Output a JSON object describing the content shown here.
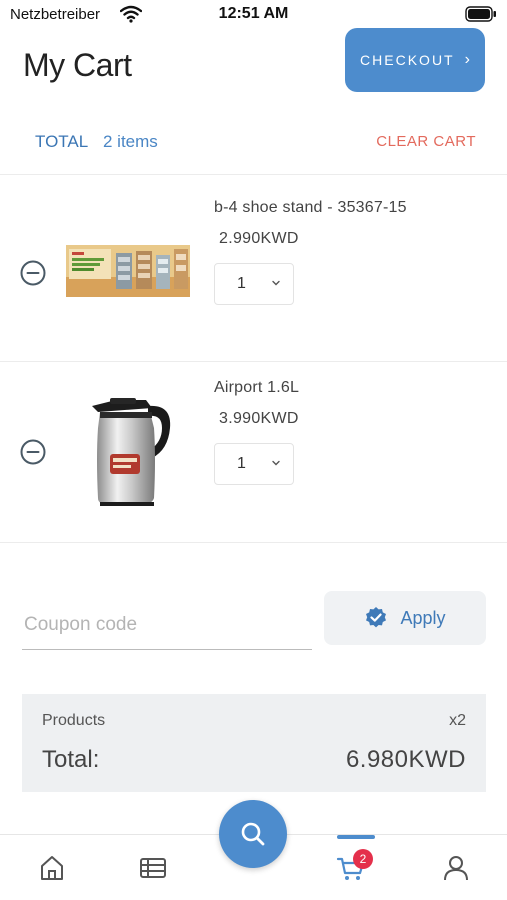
{
  "status_bar": {
    "carrier": "Netzbetreiber",
    "time": "12:51 AM"
  },
  "header": {
    "title": "My Cart",
    "checkout_label": "CHECKOUT",
    "checkout_icon": "chevron-right-icon"
  },
  "summary_row": {
    "total_label": "TOTAL",
    "items_count": "2 items",
    "clear_label": "CLEAR CART"
  },
  "cart_items": [
    {
      "name": "b-4 shoe stand - 35367-15",
      "price": "2.990KWD",
      "quantity": "1",
      "image": "shoe-stand-product"
    },
    {
      "name": "Airport 1.6L",
      "price": "3.990KWD",
      "quantity": "1",
      "image": "thermos-flask-product"
    }
  ],
  "coupon": {
    "placeholder": "Coupon code",
    "value": "",
    "apply_label": "Apply"
  },
  "totals": {
    "products_label": "Products",
    "products_qty": "x2",
    "total_label": "Total:",
    "total_amount": "6.980KWD"
  },
  "tab_bar": {
    "items": [
      "home-icon",
      "catalog-list-icon",
      "search-icon",
      "cart-icon",
      "profile-icon"
    ],
    "active": "cart-icon",
    "cart_badge": "2"
  },
  "colors": {
    "accent": "#4d8ccd",
    "danger": "#e36a5d",
    "badge": "#e4304b"
  }
}
